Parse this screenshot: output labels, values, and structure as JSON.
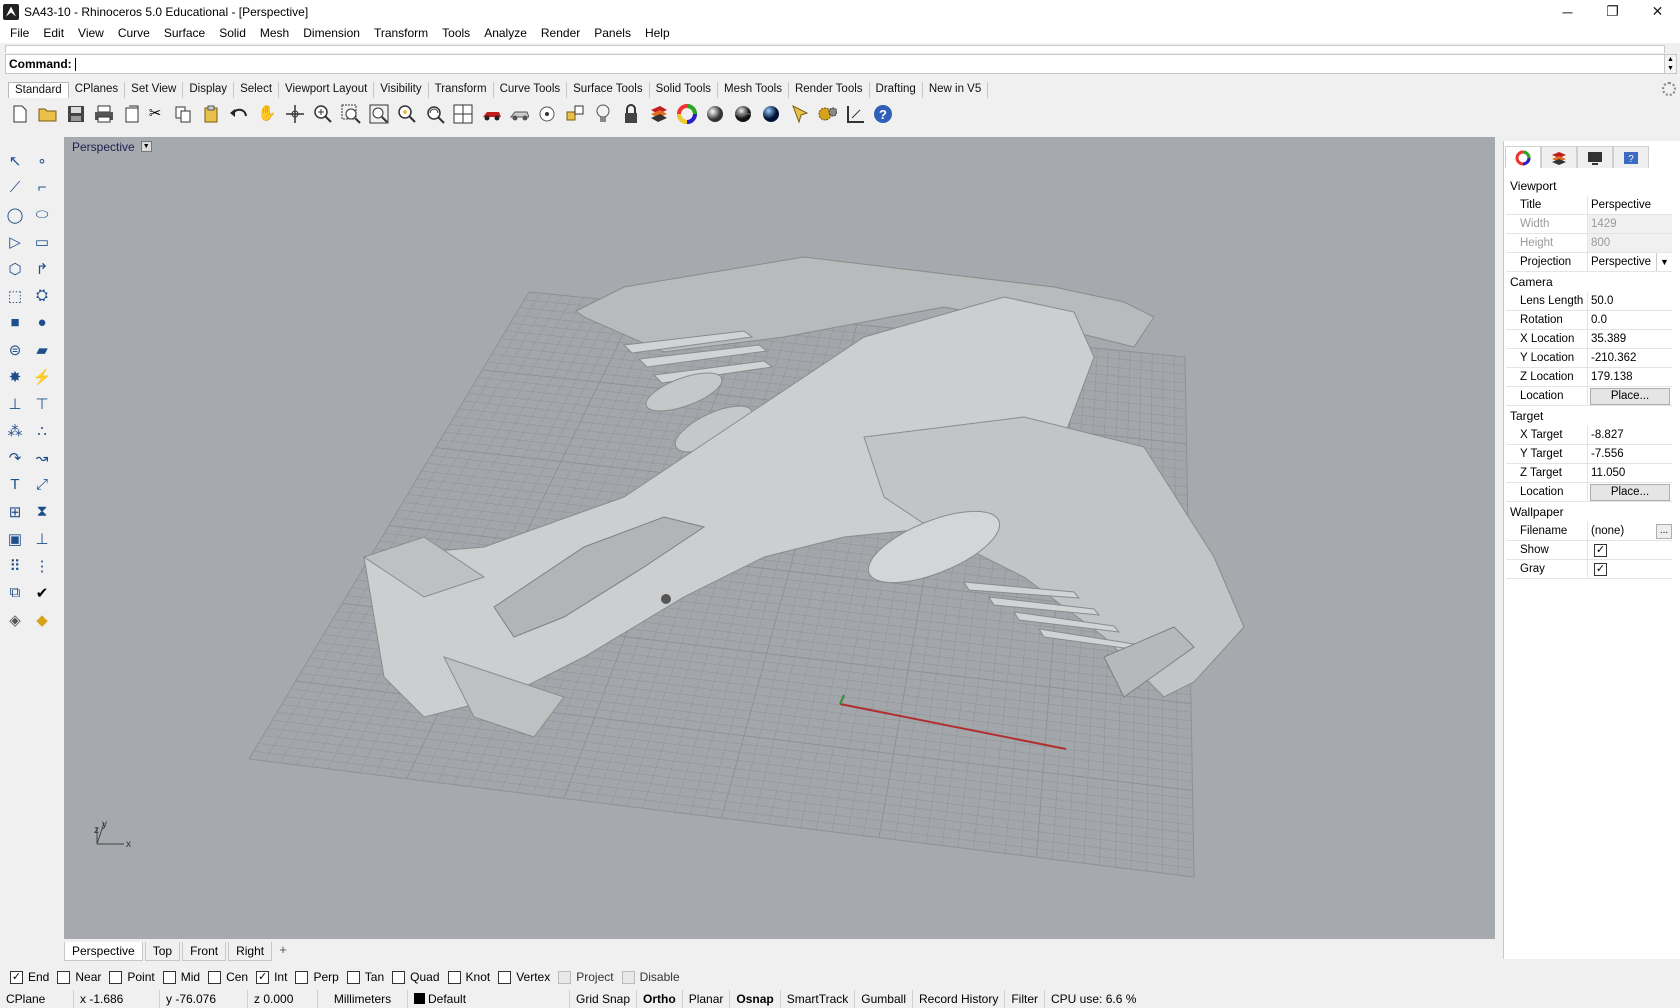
{
  "window": {
    "title": "SA43-10 - Rhinoceros 5.0 Educational - [Perspective]",
    "minimize": "─",
    "maximize": "❐",
    "close": "✕"
  },
  "menu": [
    "File",
    "Edit",
    "View",
    "Curve",
    "Surface",
    "Solid",
    "Mesh",
    "Dimension",
    "Transform",
    "Tools",
    "Analyze",
    "Render",
    "Panels",
    "Help"
  ],
  "command": {
    "label": "Command:",
    "value": ""
  },
  "toolbar_tabs": [
    "Standard",
    "CPlanes",
    "Set View",
    "Display",
    "Select",
    "Viewport Layout",
    "Visibility",
    "Transform",
    "Curve Tools",
    "Surface Tools",
    "Solid Tools",
    "Mesh Tools",
    "Render Tools",
    "Drafting",
    "New in V5"
  ],
  "viewport": {
    "title": "Perspective",
    "axis_labels": {
      "z": "z",
      "y": "y",
      "x": "x"
    },
    "tabs": [
      "Perspective",
      "Top",
      "Front",
      "Right"
    ],
    "add_tab": "+"
  },
  "properties": {
    "viewport_header": "Viewport",
    "title_label": "Title",
    "title_value": "Perspective",
    "width_label": "Width",
    "width_value": "1429",
    "height_label": "Height",
    "height_value": "800",
    "projection_label": "Projection",
    "projection_value": "Perspective",
    "camera_header": "Camera",
    "lens_label": "Lens Length",
    "lens_value": "50.0",
    "rotation_label": "Rotation",
    "rotation_value": "0.0",
    "xloc_label": "X Location",
    "xloc_value": "35.389",
    "yloc_label": "Y Location",
    "yloc_value": "-210.362",
    "zloc_label": "Z Location",
    "zloc_value": "179.138",
    "loc_label": "Location",
    "place_label": "Place...",
    "target_header": "Target",
    "xtgt_label": "X Target",
    "xtgt_value": "-8.827",
    "ytgt_label": "Y Target",
    "ytgt_value": "-7.556",
    "ztgt_label": "Z Target",
    "ztgt_value": "11.050",
    "tloc_label": "Location",
    "tplace_label": "Place...",
    "wallpaper_header": "Wallpaper",
    "filename_label": "Filename",
    "filename_value": "(none)",
    "filename_more": "...",
    "show_label": "Show",
    "show_checked": true,
    "gray_label": "Gray",
    "gray_checked": true
  },
  "osnaps": [
    {
      "label": "End",
      "checked": true
    },
    {
      "label": "Near",
      "checked": false
    },
    {
      "label": "Point",
      "checked": false
    },
    {
      "label": "Mid",
      "checked": false
    },
    {
      "label": "Cen",
      "checked": false
    },
    {
      "label": "Int",
      "checked": true
    },
    {
      "label": "Perp",
      "checked": false
    },
    {
      "label": "Tan",
      "checked": false
    },
    {
      "label": "Quad",
      "checked": false
    },
    {
      "label": "Knot",
      "checked": false
    },
    {
      "label": "Vertex",
      "checked": false
    },
    {
      "label": "Project",
      "checked": false
    },
    {
      "label": "Disable",
      "checked": false
    }
  ],
  "status": {
    "cplane": "CPlane",
    "x": "x -1.686",
    "y": "y -76.076",
    "z": "z 0.000",
    "units": "Millimeters",
    "layer": "Default",
    "grid_snap": "Grid Snap",
    "ortho": "Ortho",
    "planar": "Planar",
    "osnap": "Osnap",
    "smarttrack": "SmartTrack",
    "gumball": "Gumball",
    "record_history": "Record History",
    "filter": "Filter",
    "cpu": "CPU use: 6.6 %"
  },
  "colors": {
    "viewport_bg": "#a6a9ad",
    "grid_line": "#8e9196",
    "x_axis": "#b03030",
    "y_axis": "#2f8f2f",
    "model": "#c9cacb"
  }
}
